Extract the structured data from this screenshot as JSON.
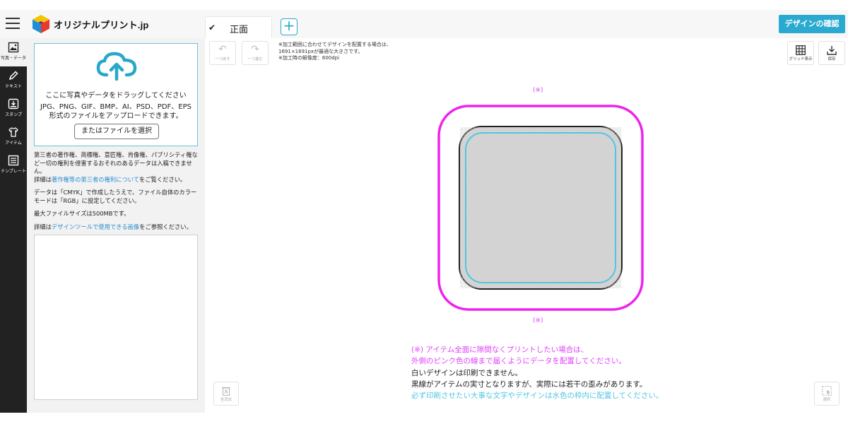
{
  "header": {
    "brand": "オリジナルプリント.jp",
    "tab_front": "正面",
    "tab_check": "✔",
    "add_tab": "+",
    "confirm_button": "デザインの確認",
    "accent": "#2aaad0"
  },
  "rail": {
    "items": [
      {
        "label": "写真・データ",
        "icon": "image-icon"
      },
      {
        "label": "テキスト",
        "icon": "pencil-icon"
      },
      {
        "label": "スタンプ",
        "icon": "stamp-icon"
      },
      {
        "label": "アイテム",
        "icon": "shirt-icon"
      },
      {
        "label": "テンプレート",
        "icon": "template-icon"
      }
    ]
  },
  "upload": {
    "main": "ここに写真やデータをドラッグしてください",
    "formats": "JPG、PNG、GIF、BMP、AI、PSD、PDF、EPS",
    "desc": "形式のファイルをアップロードできます。",
    "select_button": "またはファイルを選択"
  },
  "notes": {
    "p1": "第三者の著作権、商標権、意匠権、肖像権、パブリシティ権など一切の権利を侵害するおそれのあるデータは入稿できません。",
    "p1b_pre": "詳細は",
    "p1b_link": "著作権等の第三者の権利について",
    "p1b_post": "をご覧ください。",
    "p2": "データは「CMYK」で作成したうえで、ファイル自体のカラーモードは「RGB」に設定してください。",
    "p3": "最大ファイルサイズは500MBです。",
    "p4_pre": "詳細は",
    "p4_link": "デザインツールで使用できる画像",
    "p4_post": "をご参照ください。"
  },
  "toolbar": {
    "undo": "一つ戻す",
    "redo": "一つ進む",
    "grid": "グリッド表示",
    "save": "保存",
    "clear": "全消去",
    "select": "選択"
  },
  "canvas": {
    "hint1": "※加工範囲に合わせてデザインを配置する場合は、",
    "hint2": "1691×1691pxが最適な大きさです。",
    "hint3": "※加工時の解像度：600dpi",
    "marker_top": "(※)",
    "marker_bottom": "(※)",
    "pink_color": "#e040fb",
    "cyan_color": "#52c5e3"
  },
  "notice": {
    "line1": "(※) アイテム全面に隙間なくプリントしたい場合は、",
    "line2": "外側のピンク色の線まで届くようにデータを配置してください。",
    "line3": "白いデザインは印刷できません。",
    "line4": "黒線がアイテムの実寸となりますが、実際には若干の歪みがあります。",
    "line5": "必ず印刷させたい大事な文字やデザインは水色の枠内に配置してください。"
  }
}
